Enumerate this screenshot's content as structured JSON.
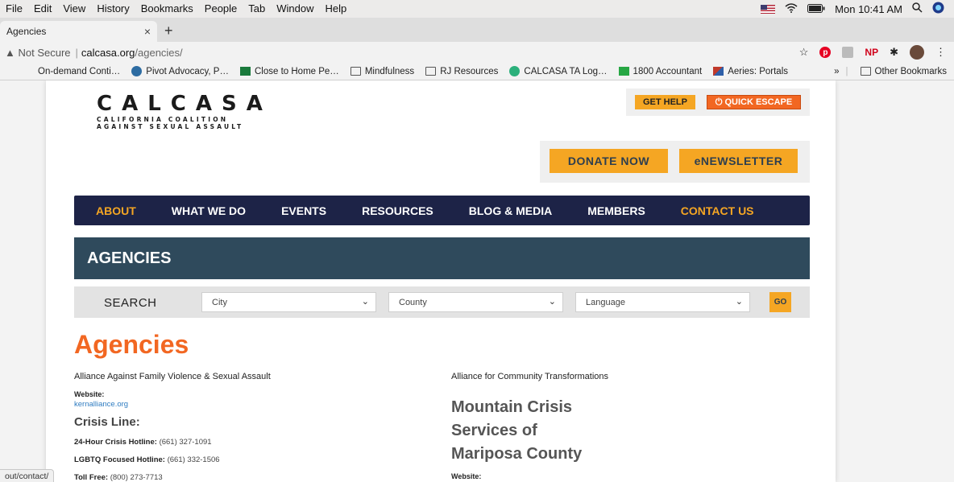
{
  "menubar": {
    "items": [
      "File",
      "Edit",
      "View",
      "History",
      "Bookmarks",
      "People",
      "Tab",
      "Window",
      "Help"
    ],
    "clock": "Mon 10:41 AM"
  },
  "browser": {
    "tab_title": "Agencies",
    "tab_close": "×",
    "new_tab": "+",
    "security": "▲ Not Secure",
    "separator": "|",
    "url_host": "calcasa.org",
    "url_path": "/agencies/",
    "bookmarks": [
      {
        "label": "On-demand Conti…",
        "icon": "none"
      },
      {
        "label": "Pivot Advocacy, P…",
        "icon": "wordpress-icon"
      },
      {
        "label": "Close to Home Pe…",
        "icon": "green-square-icon"
      },
      {
        "label": "Mindfulness",
        "icon": "folder-icon"
      },
      {
        "label": "RJ Resources",
        "icon": "folder-icon"
      },
      {
        "label": "CALCASA TA Log…",
        "icon": "teal-circle-icon"
      },
      {
        "label": "1800 Accountant",
        "icon": "grid-icon"
      },
      {
        "label": "Aeries: Portals",
        "icon": "aeries-icon"
      }
    ],
    "bookmarks_overflow": "»",
    "other_bookmarks": "Other Bookmarks",
    "status_url": "out/contact/"
  },
  "site": {
    "logo_wordmark": "CALCASA",
    "logo_tagline_1": "CALIFORNIA COALITION",
    "logo_tagline_2": "AGAINST SEXUAL ASSAULT",
    "get_help": "GET HELP",
    "quick_escape": "QUICK ESCAPE",
    "donate": "DONATE NOW",
    "newsletter": "eNEWSLETTER",
    "nav": [
      "ABOUT",
      "WHAT WE DO",
      "EVENTS",
      "RESOURCES",
      "BLOG & MEDIA",
      "MEMBERS",
      "CONTACT US"
    ],
    "banner_title": "AGENCIES",
    "search_label": "SEARCH",
    "select_city": "City",
    "select_county": "County",
    "select_language": "Language",
    "go": "GO",
    "heading": "Agencies"
  },
  "agencies": {
    "left": {
      "name": "Alliance Against Family Violence & Sexual Assault",
      "website_label": "Website:",
      "website": "kernalliance.org",
      "crisis_title": "Crisis Line:",
      "hotline_label": "24-Hour Crisis Hotline:",
      "hotline": "(661) 327-1091",
      "lgbtq_label": "LGBTQ Focused Hotline:",
      "lgbtq": "(661) 332-1506",
      "tollfree_label": "Toll Free:",
      "tollfree": "(800) 273-7713"
    },
    "right": {
      "name": "Alliance for Community Transformations",
      "big_name_1": "Mountain Crisis",
      "big_name_2": "Services of",
      "big_name_3": "Mariposa County",
      "website_label": "Website:"
    }
  },
  "colors": {
    "nav_bg": "#1d2347",
    "banner_bg": "#2f4a5c",
    "accent_orange": "#f5a623",
    "heading_orange": "#f26722",
    "link_blue": "#2f7cc1"
  }
}
